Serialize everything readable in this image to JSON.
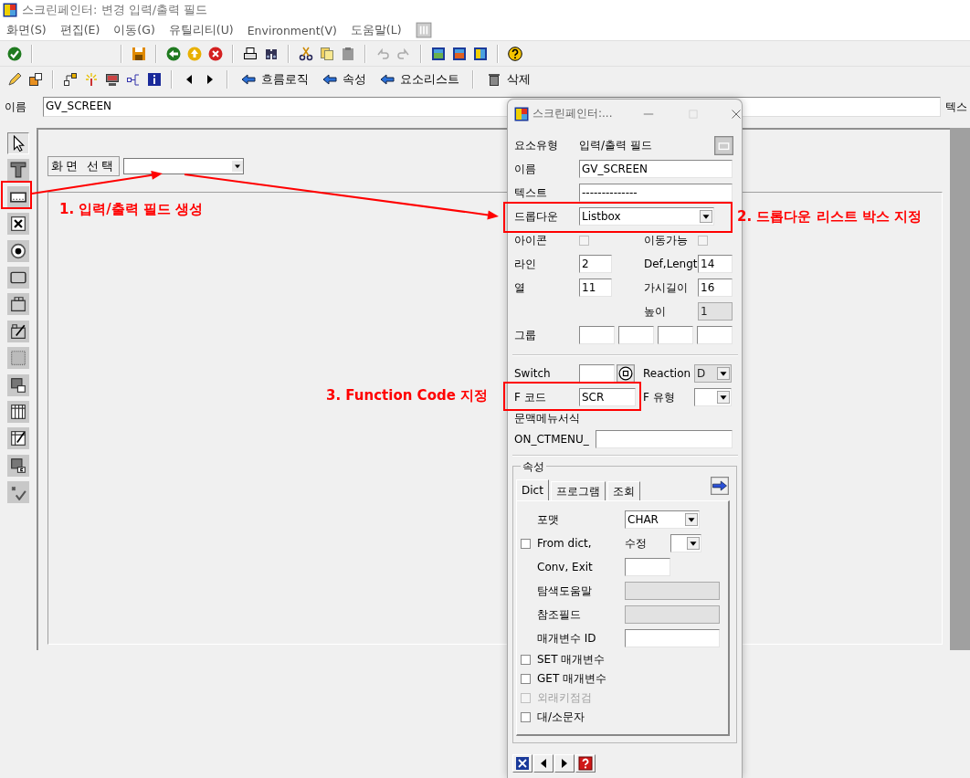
{
  "window": {
    "title": "스크린페인터: 변경 입력/출력 필드"
  },
  "menu": [
    {
      "label": "화면(S)"
    },
    {
      "label": "편집(E)"
    },
    {
      "label": "이동(G)"
    },
    {
      "label": "유틸리티(U)"
    },
    {
      "label": "Environment(V)"
    },
    {
      "label": "도움말(L)"
    }
  ],
  "app_toolbar": [
    {
      "kind": "arrow",
      "label": "흐름로직"
    },
    {
      "kind": "arrow",
      "label": "속성"
    },
    {
      "kind": "arrow",
      "label": "요소리스트"
    },
    {
      "kind": "trash",
      "label": "삭제"
    }
  ],
  "name_bar": {
    "label": "이름",
    "value": "GV_SCREEN",
    "next_label": "텍스"
  },
  "tool_palette": [
    {
      "kind": "pointer",
      "selected": true
    },
    {
      "kind": "text",
      "selected": false
    },
    {
      "kind": "io_field",
      "selected": false
    },
    {
      "kind": "checkbox",
      "selected": false
    },
    {
      "kind": "radio",
      "selected": false
    },
    {
      "kind": "pushbutton",
      "selected": false
    },
    {
      "kind": "tabstrip",
      "selected": false
    },
    {
      "kind": "tabstrip_wizard",
      "selected": false
    },
    {
      "kind": "box",
      "selected": false
    },
    {
      "kind": "subscreen",
      "selected": false
    },
    {
      "kind": "table",
      "selected": false
    },
    {
      "kind": "table_wizard",
      "selected": false
    },
    {
      "kind": "container",
      "selected": false
    },
    {
      "kind": "status_icon",
      "selected": false
    }
  ],
  "canvas": {
    "label": "화면 선택"
  },
  "dialog": {
    "title": "스크린페인터:...",
    "element_type": {
      "label": "요소유형",
      "value": "입력/출력 필드"
    },
    "name": {
      "label": "이름",
      "value": "GV_SCREEN"
    },
    "text": {
      "label": "텍스트",
      "value": "--------------"
    },
    "dropdown": {
      "label": "드롭다운",
      "value": "Listbox"
    },
    "icon": {
      "label": "아이콘",
      "checked": false
    },
    "movable": {
      "label": "이동가능",
      "checked": false
    },
    "line": {
      "label": "라인",
      "value": "2"
    },
    "def_length": {
      "label": "Def,Lengt",
      "value": "14"
    },
    "column": {
      "label": "열",
      "value": "11"
    },
    "visible_length": {
      "label": "가시길이",
      "value": "16"
    },
    "height": {
      "label": "높이",
      "value": "1",
      "disabled": true
    },
    "group": {
      "label": "그룹"
    },
    "switch": {
      "label": "Switch"
    },
    "reaction": {
      "label": "Reaction",
      "value": "D",
      "disabled": true
    },
    "function_code": {
      "label": "F 코드",
      "value": "SCR"
    },
    "function_type": {
      "label": "F 유형"
    },
    "context_menu": {
      "label": "문맥메뉴서식",
      "prefix": "ON_CTMENU_"
    },
    "attributes": {
      "legend": "속성",
      "tabs": [
        {
          "label": "Dict",
          "selected": true
        },
        {
          "label": "프로그램",
          "selected": false
        },
        {
          "label": "조회",
          "selected": false
        }
      ],
      "rows": [
        {
          "kind": "dropdown",
          "label": "포맷",
          "value": "CHAR",
          "disabled": false
        },
        {
          "kind": "check_dropdown",
          "label": "From dict,",
          "checked": false,
          "option_label": "수정",
          "disabled": false
        },
        {
          "kind": "field",
          "label": "Conv, Exit",
          "disabled": false
        },
        {
          "kind": "field",
          "label": "탐색도움말",
          "disabled": true
        },
        {
          "kind": "field",
          "label": "참조필드",
          "disabled": true
        },
        {
          "kind": "field",
          "label": "매개변수 ID",
          "disabled": false
        },
        {
          "kind": "check",
          "label": "SET 매개변수",
          "checked": false,
          "disabled": false
        },
        {
          "kind": "check",
          "label": "GET 매개변수",
          "checked": false,
          "disabled": false
        },
        {
          "kind": "check",
          "label": "외래키점검",
          "checked": false,
          "disabled": true
        },
        {
          "kind": "check",
          "label": "대/소문자",
          "checked": false,
          "disabled": false
        }
      ]
    }
  },
  "annotations": [
    {
      "text": "1. 입력/출력 필드 생성"
    },
    {
      "text": "2. 드롭다운 리스트 박스 지정"
    },
    {
      "text": "3. Function Code 지정"
    }
  ]
}
